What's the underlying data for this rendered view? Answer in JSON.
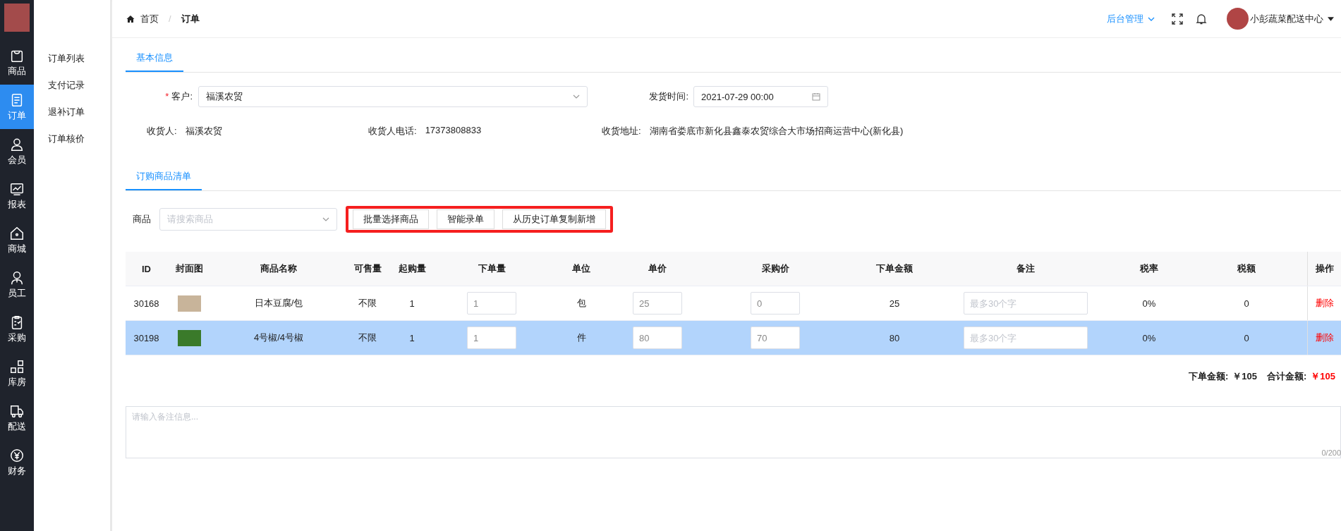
{
  "nav": [
    {
      "label": "商品",
      "selected": false
    },
    {
      "label": "订单",
      "selected": true
    },
    {
      "label": "会员",
      "selected": false
    },
    {
      "label": "报表",
      "selected": false
    },
    {
      "label": "商城",
      "selected": false
    },
    {
      "label": "员工",
      "selected": false
    },
    {
      "label": "采购",
      "selected": false
    },
    {
      "label": "库房",
      "selected": false
    },
    {
      "label": "配送",
      "selected": false
    },
    {
      "label": "财务",
      "selected": false
    }
  ],
  "submenu": [
    {
      "label": "订单列表",
      "selected": false
    },
    {
      "label": "支付记录",
      "selected": false
    },
    {
      "label": "退补订单",
      "selected": false
    },
    {
      "label": "订单核价",
      "selected": false
    }
  ],
  "breadcrumb": [
    "首页",
    "订单"
  ],
  "breadcrumb_separator": "/",
  "header": {
    "admin_menu": "后台管理",
    "user_name": "小彭蔬菜配送中心"
  },
  "basic_tab": "基本信息",
  "customer": {
    "required_mark": "*",
    "label": "客户:",
    "value": "福溪农贸"
  },
  "ship_time": {
    "label": "发货时间:",
    "value": "2021-07-29 00:00"
  },
  "receiver": {
    "label": "收货人:",
    "value": "福溪农贸"
  },
  "phone": {
    "label": "收货人电话:",
    "value": "17373808833"
  },
  "address": {
    "label": "收货地址:",
    "value": "湖南省娄底市新化县鑫泰农贸综合大市场招商运营中心(新化县)"
  },
  "goods_tab": "订购商品清单",
  "goods_search": {
    "label": "商品",
    "placeholder": "请搜索商品"
  },
  "actions": [
    "批量选择商品",
    "智能录单",
    "从历史订单复制新增"
  ],
  "table": {
    "columns": [
      "ID",
      "封面图",
      "商品名称",
      "可售量",
      "起购量",
      "下单量",
      "单位",
      "单价",
      "采购价",
      "下单金额",
      "备注",
      "税率",
      "税额",
      "操作"
    ],
    "rows": [
      {
        "id": "30168",
        "name": "日本豆腐/包",
        "stock": "不限",
        "min": "1",
        "qty": "1",
        "unit": "包",
        "price": "25",
        "cost": "0",
        "amount": "25",
        "note_placeholder": "最多30个字",
        "tax_rate": "0%",
        "tax": "0",
        "action": "删除",
        "selected": false
      },
      {
        "id": "30198",
        "name": "4号椒/4号椒",
        "stock": "不限",
        "min": "1",
        "qty": "1",
        "unit": "件",
        "price": "80",
        "cost": "70",
        "amount": "80",
        "note_placeholder": "最多30个字",
        "tax_rate": "0%",
        "tax": "0",
        "action": "删除",
        "selected": true
      }
    ]
  },
  "totals": {
    "order_label": "下单金额:",
    "order_value": "￥105",
    "total_label": "合计金额:",
    "total_value": "￥105"
  },
  "remark": {
    "placeholder": "请输入备注信息...",
    "counter": "0/200"
  }
}
